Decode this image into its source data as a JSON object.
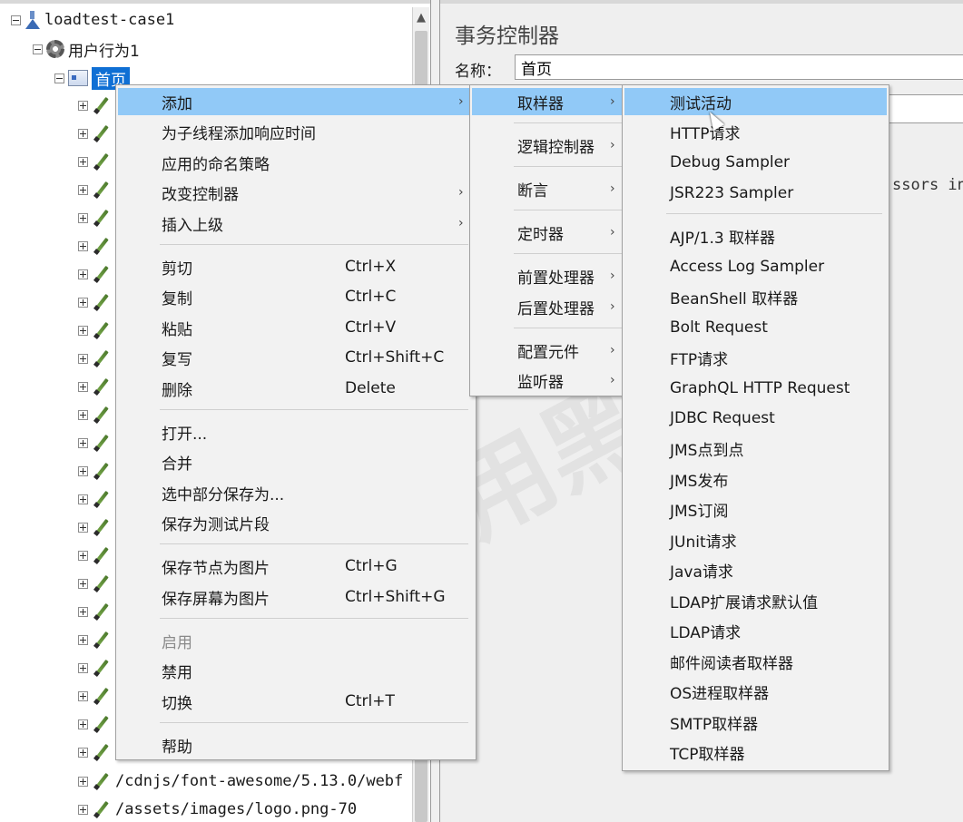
{
  "tree": {
    "root": "loadtest-case1",
    "thread_group": "用户行为1",
    "selected": "首页",
    "visible_items": [
      "/cdnjs/font-awesome/5.13.0/webf",
      "/assets/images/logo.png-70"
    ]
  },
  "editor": {
    "title": "事务控制器",
    "name_label": "名称：",
    "name_value": "首页",
    "fragment": "ssors in"
  },
  "context_menu": {
    "items": [
      {
        "label": "添加",
        "submenu": true,
        "highlighted": true
      },
      {
        "label": "为子线程添加响应时间"
      },
      {
        "label": "应用的命名策略"
      },
      {
        "label": "改变控制器",
        "submenu": true
      },
      {
        "label": "插入上级",
        "submenu": true
      },
      {
        "label": "剪切",
        "shortcut": "Ctrl+X"
      },
      {
        "label": "复制",
        "shortcut": "Ctrl+C"
      },
      {
        "label": "粘贴",
        "shortcut": "Ctrl+V"
      },
      {
        "label": "复写",
        "shortcut": "Ctrl+Shift+C"
      },
      {
        "label": "删除",
        "shortcut": "Delete"
      },
      {
        "label": "打开..."
      },
      {
        "label": "合并"
      },
      {
        "label": "选中部分保存为..."
      },
      {
        "label": "保存为测试片段"
      },
      {
        "label": "保存节点为图片",
        "shortcut": "Ctrl+G"
      },
      {
        "label": "保存屏幕为图片",
        "shortcut": "Ctrl+Shift+G"
      },
      {
        "label": "启用",
        "disabled": true
      },
      {
        "label": "禁用"
      },
      {
        "label": "切换",
        "shortcut": "Ctrl+T"
      },
      {
        "label": "帮助"
      }
    ]
  },
  "add_submenu": {
    "items": [
      "取样器",
      "逻辑控制器",
      "断言",
      "定时器",
      "前置处理器",
      "后置处理器",
      "配置元件",
      "监听器"
    ]
  },
  "sampler_submenu": {
    "items": [
      "测试活动",
      "HTTP请求",
      "Debug Sampler",
      "JSR223 Sampler",
      "AJP/1.3 取样器",
      "Access Log Sampler",
      "BeanShell 取样器",
      "Bolt Request",
      "FTP请求",
      "GraphQL HTTP Request",
      "JDBC Request",
      "JMS点到点",
      "JMS发布",
      "JMS订阅",
      "JUnit请求",
      "Java请求",
      "LDAP扩展请求默认值",
      "LDAP请求",
      "邮件阅读者取样器",
      "OS进程取样器",
      "SMTP取样器",
      "TCP取样器"
    ]
  },
  "watermark": "自用黑客",
  "colors": {
    "highlight": "#91c9f7",
    "selection": "#0f6fd4"
  }
}
